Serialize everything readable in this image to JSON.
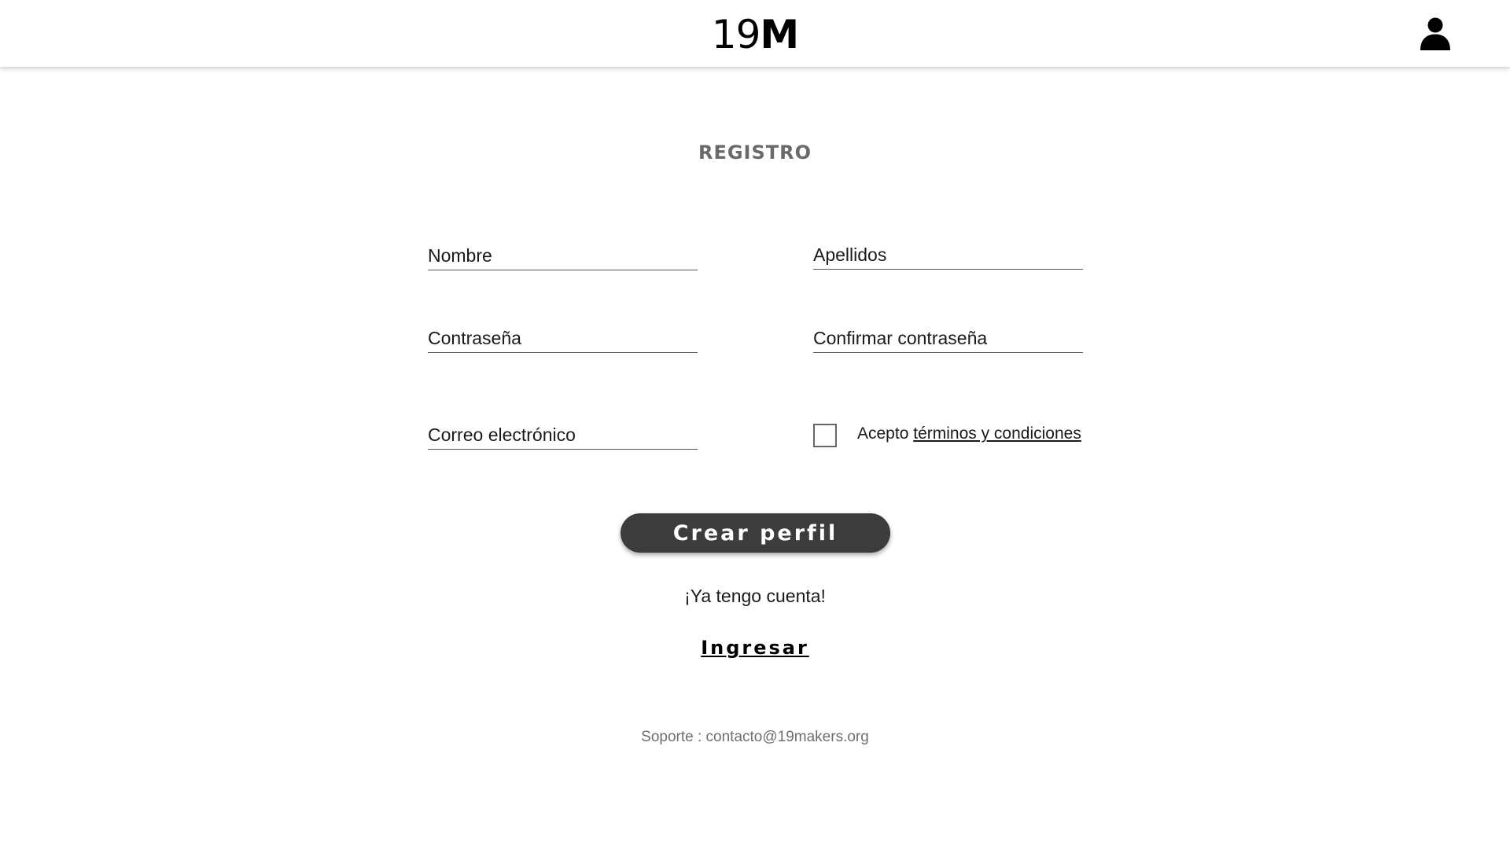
{
  "header": {
    "logo_num": "19",
    "logo_letter": "M"
  },
  "form": {
    "title": "REGISTRO",
    "fields": {
      "first_name": {
        "placeholder": "Nombre",
        "value": ""
      },
      "last_name": {
        "placeholder": "Apellidos",
        "value": ""
      },
      "password": {
        "placeholder": "Contraseña",
        "value": ""
      },
      "confirm_password": {
        "placeholder": "Confirmar contraseña",
        "value": ""
      },
      "email": {
        "placeholder": "Correo electrónico",
        "value": ""
      }
    },
    "terms": {
      "prefix": "Acepto",
      "link": "términos y condiciones",
      "checked": false
    },
    "submit_label": "Crear perfil"
  },
  "login": {
    "prompt": "¡Ya tengo cuenta!",
    "link_label": "Ingresar"
  },
  "footer": {
    "support": "Soporte : contacto@19makers.org"
  },
  "icons": {
    "profile": "user-icon"
  },
  "colors": {
    "button_bg": "#3c3c3c",
    "title": "#6a6a6a",
    "support_text": "#6e6e6e"
  }
}
